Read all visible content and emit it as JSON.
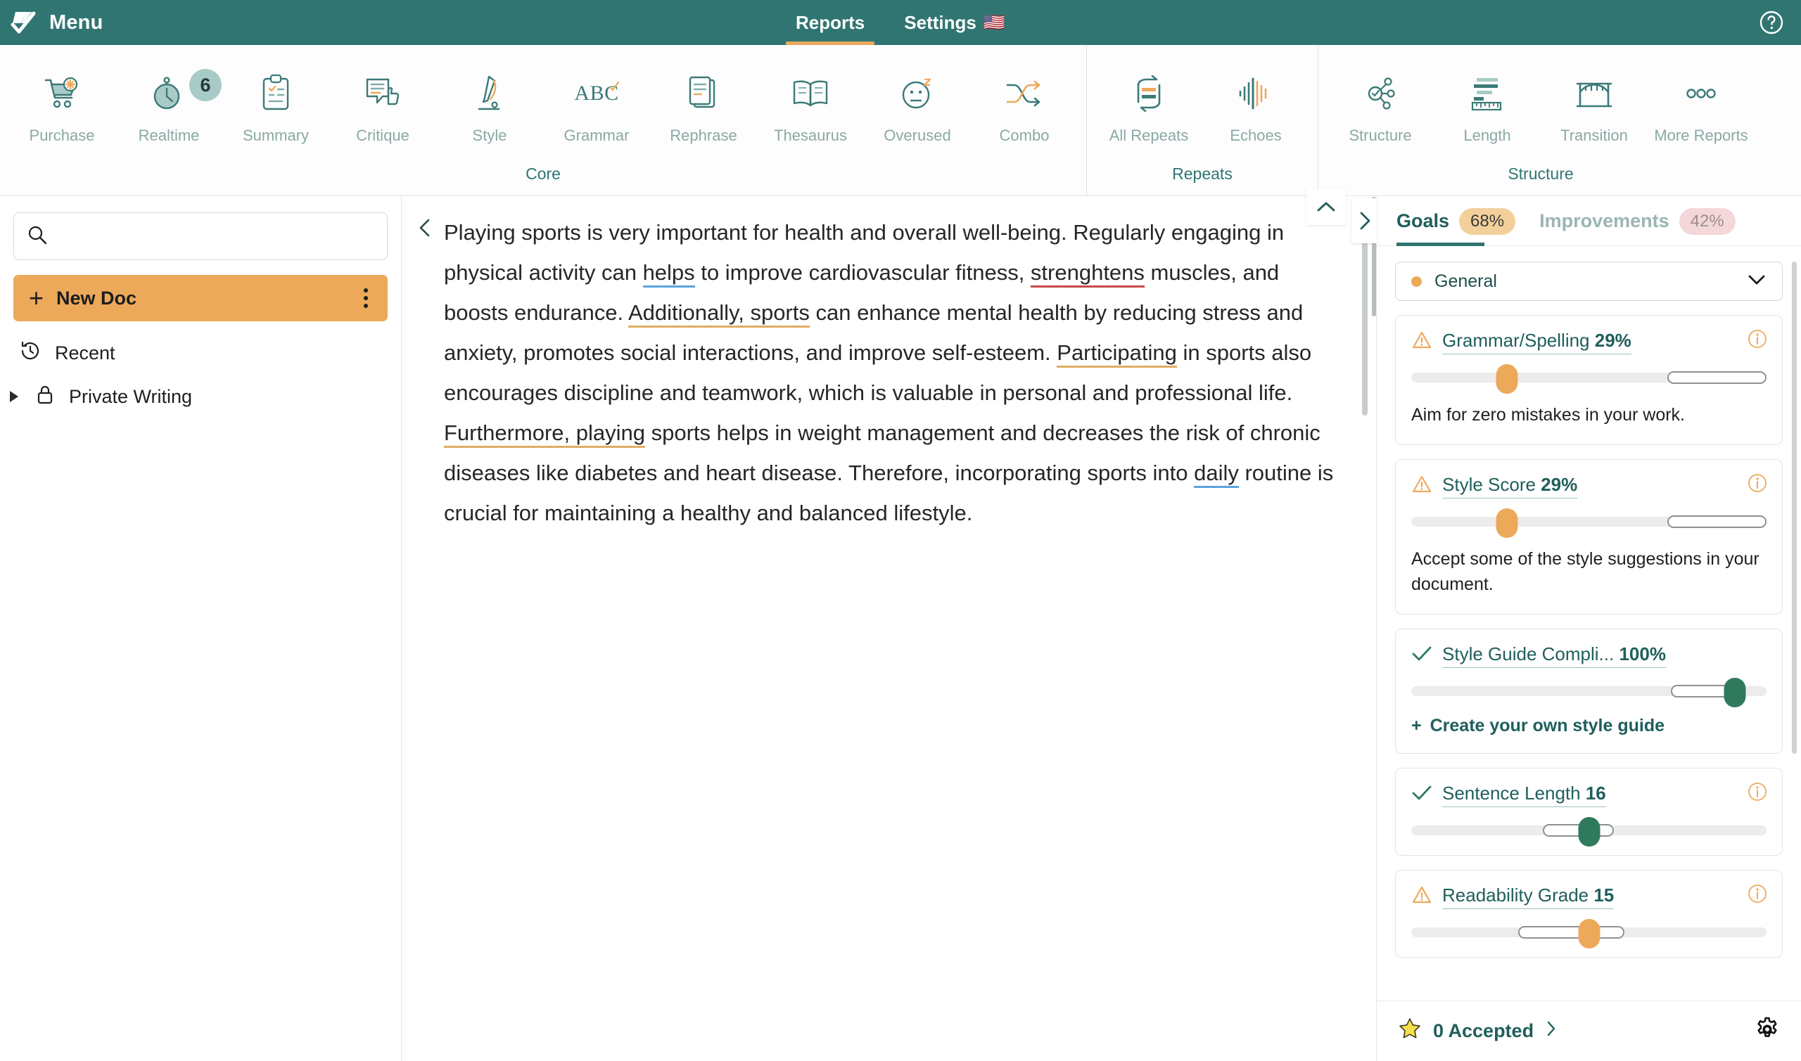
{
  "app": {
    "brand": "Menu",
    "logo_icon": "prowritingaid-logo-icon",
    "help_icon": "help-circle-icon"
  },
  "topnav": {
    "items": [
      {
        "label": "Reports",
        "active": true
      },
      {
        "label": "Settings",
        "active": false
      }
    ],
    "language_flag": "🇺🇸"
  },
  "ribbon": {
    "groups": [
      {
        "label": "Core",
        "tools": [
          {
            "label": "Purchase",
            "icon": "shopping-cart-icon",
            "badge": null
          },
          {
            "label": "Realtime",
            "icon": "stopwatch-icon",
            "badge": "6"
          },
          {
            "label": "Summary",
            "icon": "clipboard-list-icon",
            "badge": null
          },
          {
            "label": "Critique",
            "icon": "comment-thumbsup-icon",
            "badge": null
          },
          {
            "label": "Style",
            "icon": "fountain-pen-icon",
            "badge": null
          },
          {
            "label": "Grammar",
            "icon": "abc-check-icon",
            "badge": null
          },
          {
            "label": "Rephrase",
            "icon": "rephrase-page-icon",
            "badge": null
          },
          {
            "label": "Thesaurus",
            "icon": "open-book-icon",
            "badge": null
          },
          {
            "label": "Overused",
            "icon": "sleepy-face-icon",
            "badge": null
          },
          {
            "label": "Combo",
            "icon": "shuffle-arrows-icon",
            "badge": null
          }
        ]
      },
      {
        "label": "Repeats",
        "tools": [
          {
            "label": "All Repeats",
            "icon": "repeat-arrows-icon",
            "badge": null
          },
          {
            "label": "Echoes",
            "icon": "waveform-icon",
            "badge": null
          }
        ]
      },
      {
        "label": "Structure",
        "tools": [
          {
            "label": "Structure",
            "icon": "node-graph-icon",
            "badge": null
          },
          {
            "label": "Length",
            "icon": "ruler-bars-icon",
            "badge": null
          },
          {
            "label": "Transition",
            "icon": "bridge-icon",
            "badge": null
          },
          {
            "label": "More Reports",
            "icon": "ellipsis-icon",
            "badge": null
          }
        ]
      }
    ]
  },
  "sidebar": {
    "search": {
      "placeholder": "",
      "value": "",
      "icon": "search-icon"
    },
    "new_doc": {
      "label": "New Doc",
      "plus": "+",
      "menu_icon": "kebab-menu-icon"
    },
    "items": [
      {
        "label": "Recent",
        "icon": "history-clock-icon",
        "expandable": false
      },
      {
        "label": "Private Writing",
        "icon": "lock-icon",
        "expandable": true
      }
    ]
  },
  "editor": {
    "collapse_icon": "chevron-left-icon",
    "paragraph": [
      {
        "t": "Playing sports is very important for health and overall well-being. Regularly engaging in physical activity can "
      },
      {
        "t": "helps",
        "u": "blue"
      },
      {
        "t": " to improve cardiovascular fitness, "
      },
      {
        "t": "strenghtens",
        "u": "red"
      },
      {
        "t": " muscles, and boosts endurance. "
      },
      {
        "t": "Additionally, sports",
        "u": "amber"
      },
      {
        "t": " can enhance mental health by reducing stress and anxiety, promotes social interactions, and improve self-esteem. "
      },
      {
        "t": "Participating",
        "u": "amber"
      },
      {
        "t": " in sports also encourages discipline and teamwork, which is valuable in personal and professional life. "
      },
      {
        "t": "Furthermore, playing",
        "u": "amber"
      },
      {
        "t": " sports helps in weight management and decreases the risk of chronic diseases like diabetes and heart disease. Therefore, incorporating sports into "
      },
      {
        "t": "daily",
        "u": "blue"
      },
      {
        "t": " routine is crucial for maintaining a healthy and balanced lifestyle."
      }
    ]
  },
  "panel": {
    "expand_icon": "chevron-right-icon",
    "updown_icon": "chevron-up-icon",
    "tabs": [
      {
        "label": "Goals",
        "pill": "68%",
        "active": true
      },
      {
        "label": "Improvements",
        "pill": "42%",
        "active": false
      }
    ],
    "document_type": {
      "label": "General",
      "chevron_icon": "chevron-down-icon"
    },
    "goals": [
      {
        "title": "Grammar/Spelling",
        "value": "29%",
        "status": "warning",
        "status_icon": "warning-triangle-icon",
        "info_icon": "info-circle-icon",
        "thumb_pct": 27,
        "target_start_pct": 72,
        "target_end_pct": 100,
        "thumb_color": "#eda95a",
        "description": "Aim for zero mistakes in your work."
      },
      {
        "title": "Style Score",
        "value": "29%",
        "status": "warning",
        "status_icon": "warning-triangle-icon",
        "info_icon": "info-circle-icon",
        "thumb_pct": 27,
        "target_start_pct": 72,
        "target_end_pct": 100,
        "thumb_color": "#eda95a",
        "description": "Accept some of the style suggestions in your document."
      },
      {
        "title": "Style Guide Compli...",
        "value": "100%",
        "status": "ok",
        "status_icon": "check-icon",
        "info_icon": null,
        "thumb_pct": 91,
        "target_start_pct": 73,
        "target_end_pct": 94,
        "thumb_color": "#2f7a5d",
        "description": null,
        "action": {
          "label": "Create your own style guide",
          "plus": "+"
        }
      },
      {
        "title": "Sentence Length",
        "value": "16",
        "status": "ok",
        "status_icon": "check-icon",
        "info_icon": "info-circle-icon",
        "thumb_pct": 50,
        "target_start_pct": 37,
        "target_end_pct": 57,
        "thumb_color": "#2f7a5d",
        "description": null
      },
      {
        "title": "Readability Grade",
        "value": "15",
        "status": "warning",
        "status_icon": "warning-triangle-icon",
        "info_icon": "info-circle-icon",
        "thumb_pct": 50,
        "target_start_pct": 30,
        "target_end_pct": 60,
        "thumb_color": "#eda95a",
        "description": null
      }
    ],
    "footer": {
      "accepted_label": "0 Accepted",
      "star_icon": "star-icon",
      "chevron_icon": "chevron-right-icon",
      "settings_icon": "gear-icon"
    }
  },
  "colors": {
    "brand_teal": "#317572",
    "accent_orange": "#eda95a",
    "goal_green": "#2f7a5d",
    "error_red": "#c8484a",
    "suggestion_blue": "#5ba3de"
  }
}
